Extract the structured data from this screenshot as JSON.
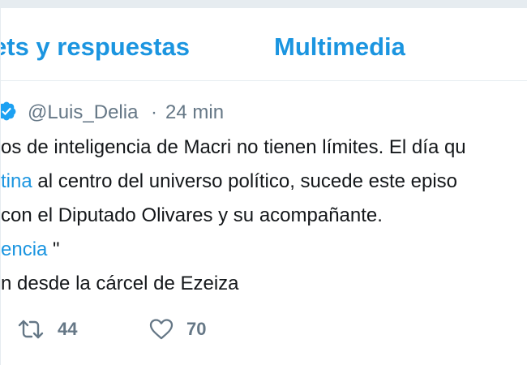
{
  "tabs": {
    "replies_label": "ets y respuestas",
    "media_label": "Multimedia"
  },
  "tweet": {
    "handle": "@Luis_Delia",
    "separator": "·",
    "time": "24 min",
    "lines": [
      "os de inteligencia de Macri no tienen límites. El día qu",
      "al centro del universo político, sucede este episo",
      "con el Diputado  Olivares y su acompañante.",
      "\"",
      "n desde la cárcel de Ezeiza"
    ],
    "line2_link": "tina",
    "line4_link": "encia",
    "retweet_count": "44",
    "like_count": "70"
  },
  "colors": {
    "accent": "#1b95e0",
    "muted": "#657786",
    "background": "#e6ecf0"
  },
  "icons": [
    "verified-badge-icon",
    "retweet-icon",
    "heart-icon"
  ]
}
